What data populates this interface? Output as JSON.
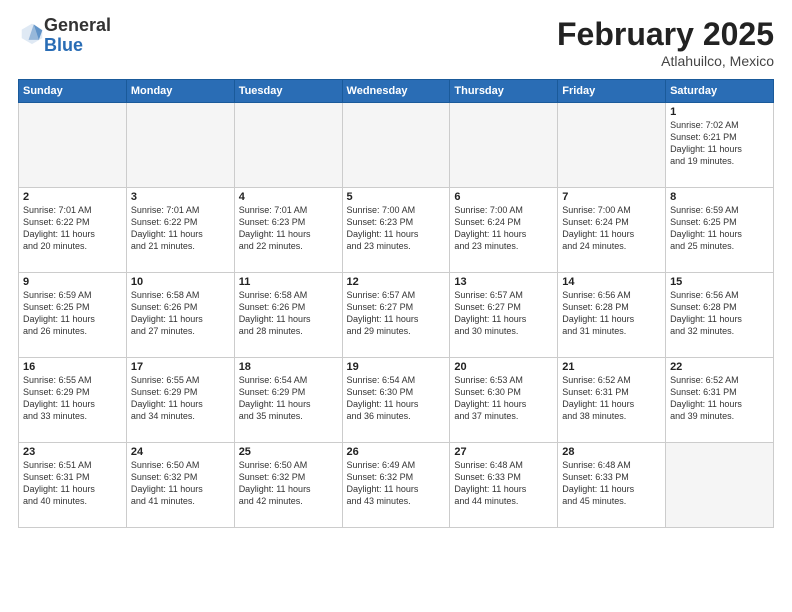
{
  "header": {
    "logo_general": "General",
    "logo_blue": "Blue",
    "title": "February 2025",
    "location": "Atlahuilco, Mexico"
  },
  "weekdays": [
    "Sunday",
    "Monday",
    "Tuesday",
    "Wednesday",
    "Thursday",
    "Friday",
    "Saturday"
  ],
  "weeks": [
    [
      {
        "day": "",
        "info": ""
      },
      {
        "day": "",
        "info": ""
      },
      {
        "day": "",
        "info": ""
      },
      {
        "day": "",
        "info": ""
      },
      {
        "day": "",
        "info": ""
      },
      {
        "day": "",
        "info": ""
      },
      {
        "day": "1",
        "info": "Sunrise: 7:02 AM\nSunset: 6:21 PM\nDaylight: 11 hours\nand 19 minutes."
      }
    ],
    [
      {
        "day": "2",
        "info": "Sunrise: 7:01 AM\nSunset: 6:22 PM\nDaylight: 11 hours\nand 20 minutes."
      },
      {
        "day": "3",
        "info": "Sunrise: 7:01 AM\nSunset: 6:22 PM\nDaylight: 11 hours\nand 21 minutes."
      },
      {
        "day": "4",
        "info": "Sunrise: 7:01 AM\nSunset: 6:23 PM\nDaylight: 11 hours\nand 22 minutes."
      },
      {
        "day": "5",
        "info": "Sunrise: 7:00 AM\nSunset: 6:23 PM\nDaylight: 11 hours\nand 23 minutes."
      },
      {
        "day": "6",
        "info": "Sunrise: 7:00 AM\nSunset: 6:24 PM\nDaylight: 11 hours\nand 23 minutes."
      },
      {
        "day": "7",
        "info": "Sunrise: 7:00 AM\nSunset: 6:24 PM\nDaylight: 11 hours\nand 24 minutes."
      },
      {
        "day": "8",
        "info": "Sunrise: 6:59 AM\nSunset: 6:25 PM\nDaylight: 11 hours\nand 25 minutes."
      }
    ],
    [
      {
        "day": "9",
        "info": "Sunrise: 6:59 AM\nSunset: 6:25 PM\nDaylight: 11 hours\nand 26 minutes."
      },
      {
        "day": "10",
        "info": "Sunrise: 6:58 AM\nSunset: 6:26 PM\nDaylight: 11 hours\nand 27 minutes."
      },
      {
        "day": "11",
        "info": "Sunrise: 6:58 AM\nSunset: 6:26 PM\nDaylight: 11 hours\nand 28 minutes."
      },
      {
        "day": "12",
        "info": "Sunrise: 6:57 AM\nSunset: 6:27 PM\nDaylight: 11 hours\nand 29 minutes."
      },
      {
        "day": "13",
        "info": "Sunrise: 6:57 AM\nSunset: 6:27 PM\nDaylight: 11 hours\nand 30 minutes."
      },
      {
        "day": "14",
        "info": "Sunrise: 6:56 AM\nSunset: 6:28 PM\nDaylight: 11 hours\nand 31 minutes."
      },
      {
        "day": "15",
        "info": "Sunrise: 6:56 AM\nSunset: 6:28 PM\nDaylight: 11 hours\nand 32 minutes."
      }
    ],
    [
      {
        "day": "16",
        "info": "Sunrise: 6:55 AM\nSunset: 6:29 PM\nDaylight: 11 hours\nand 33 minutes."
      },
      {
        "day": "17",
        "info": "Sunrise: 6:55 AM\nSunset: 6:29 PM\nDaylight: 11 hours\nand 34 minutes."
      },
      {
        "day": "18",
        "info": "Sunrise: 6:54 AM\nSunset: 6:29 PM\nDaylight: 11 hours\nand 35 minutes."
      },
      {
        "day": "19",
        "info": "Sunrise: 6:54 AM\nSunset: 6:30 PM\nDaylight: 11 hours\nand 36 minutes."
      },
      {
        "day": "20",
        "info": "Sunrise: 6:53 AM\nSunset: 6:30 PM\nDaylight: 11 hours\nand 37 minutes."
      },
      {
        "day": "21",
        "info": "Sunrise: 6:52 AM\nSunset: 6:31 PM\nDaylight: 11 hours\nand 38 minutes."
      },
      {
        "day": "22",
        "info": "Sunrise: 6:52 AM\nSunset: 6:31 PM\nDaylight: 11 hours\nand 39 minutes."
      }
    ],
    [
      {
        "day": "23",
        "info": "Sunrise: 6:51 AM\nSunset: 6:31 PM\nDaylight: 11 hours\nand 40 minutes."
      },
      {
        "day": "24",
        "info": "Sunrise: 6:50 AM\nSunset: 6:32 PM\nDaylight: 11 hours\nand 41 minutes."
      },
      {
        "day": "25",
        "info": "Sunrise: 6:50 AM\nSunset: 6:32 PM\nDaylight: 11 hours\nand 42 minutes."
      },
      {
        "day": "26",
        "info": "Sunrise: 6:49 AM\nSunset: 6:32 PM\nDaylight: 11 hours\nand 43 minutes."
      },
      {
        "day": "27",
        "info": "Sunrise: 6:48 AM\nSunset: 6:33 PM\nDaylight: 11 hours\nand 44 minutes."
      },
      {
        "day": "28",
        "info": "Sunrise: 6:48 AM\nSunset: 6:33 PM\nDaylight: 11 hours\nand 45 minutes."
      },
      {
        "day": "",
        "info": ""
      }
    ]
  ]
}
